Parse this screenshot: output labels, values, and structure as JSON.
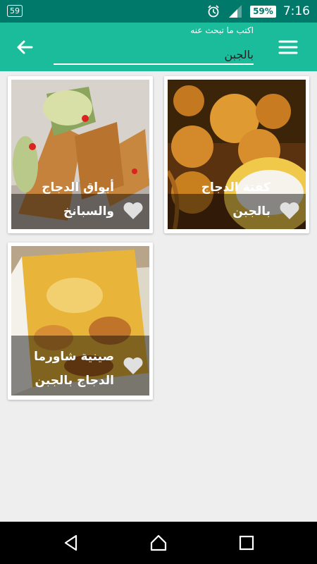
{
  "status_bar": {
    "notification_count": "59",
    "battery": "59%",
    "time": "7:16"
  },
  "search": {
    "hint": "اكتب ما تبحث عنه",
    "value": "بالجبن"
  },
  "recipes": [
    {
      "title": "كفتة الدجاج بالجبن",
      "image": "chicken-cheese-balls-photo"
    },
    {
      "title": "أبواق الدجاج والسبانخ",
      "image": "chicken-spinach-horns-photo"
    },
    {
      "title": "صينية شاورما الدجاج بالجبن",
      "image": "chicken-shawarma-tray-photo"
    }
  ],
  "colors": {
    "status_bar": "#00796b",
    "app_bar": "#1abc9c",
    "background": "#eeeeee"
  }
}
